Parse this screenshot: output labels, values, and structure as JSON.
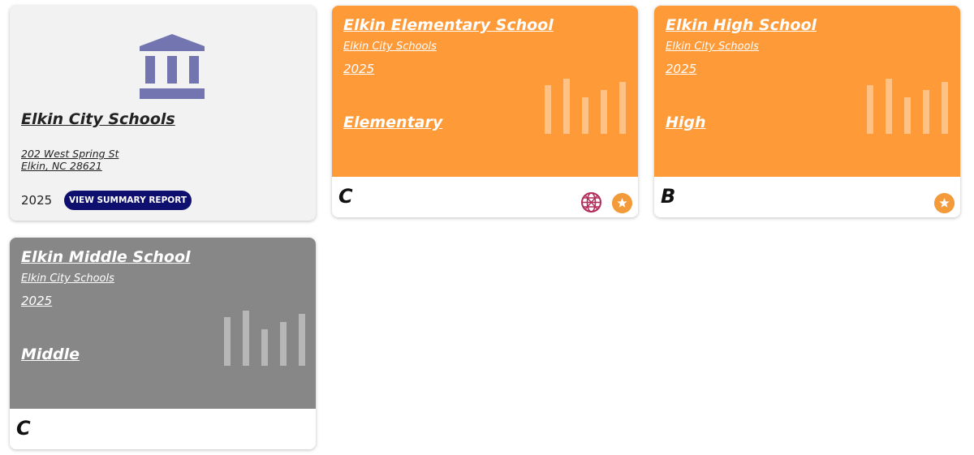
{
  "colors": {
    "orange_card": "#fe9a38",
    "gray_card": "#878787",
    "district_bg": "#f2f2f2",
    "report_button": "#0e0f6e",
    "building_icon": "#7275b0",
    "globe_icon": "#b22c5a",
    "star_badge": "#f39a3a"
  },
  "district": {
    "icon": "government-building-icon",
    "name": "Elkin City Schools",
    "address_line1": "202 West Spring St",
    "address_line2": "Elkin, NC 28621",
    "year": "2025",
    "report_button": "VIEW SUMMARY REPORT"
  },
  "schools": [
    {
      "name": "Elkin Elementary School",
      "district": "Elkin City Schools",
      "year": "2025",
      "level": "Elementary",
      "grade": "C",
      "badges": [
        "globe-icon",
        "star-icon"
      ]
    },
    {
      "name": "Elkin High School",
      "district": "Elkin City Schools",
      "year": "2025",
      "level": "High",
      "grade": "B",
      "badges": [
        "star-icon"
      ]
    },
    {
      "name": "Elkin Middle School",
      "district": "Elkin City Schools",
      "year": "2025",
      "level": "Middle",
      "grade": "C",
      "badges": []
    }
  ]
}
